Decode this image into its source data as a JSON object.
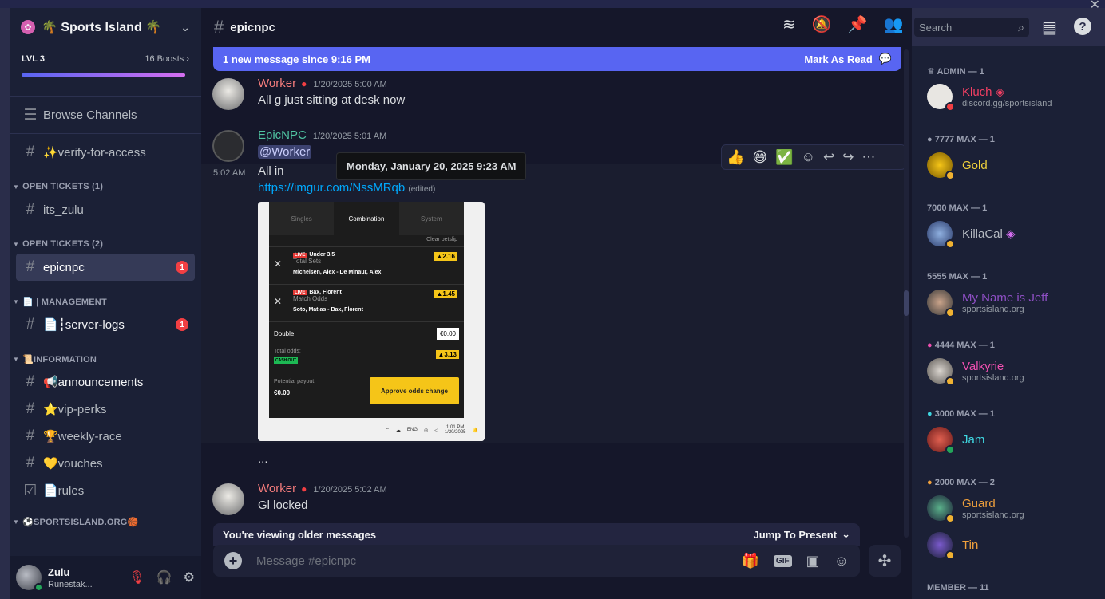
{
  "server": {
    "name": "🌴 Sports Island 🌴",
    "level": "LVL 3",
    "boosts": "16 Boosts"
  },
  "sidebar": {
    "browse": "Browse Channels",
    "verify": "✨verify-for-access",
    "cat_open1": "OPEN TICKETS (1)",
    "ticket1": "its_zulu",
    "cat_open2": "OPEN TICKETS (2)",
    "ticket2": "epicnpc",
    "ticket2_badge": "1",
    "cat_mgmt": "📄 | MANAGEMENT",
    "server_logs": "📄┇server-logs",
    "server_logs_badge": "1",
    "cat_info": "📜INFORMATION",
    "announcements": "📢announcements",
    "vip": "⭐vip-perks",
    "weekly": "🏆weekly-race",
    "vouches": "💛vouches",
    "rules": "📄rules",
    "cat_sports": "⚽SPORTSISLAND.ORG🏀"
  },
  "user": {
    "name": "Zulu",
    "status": "Runestak..."
  },
  "chat": {
    "channel": "epicnpc",
    "new_messages": "1 new message since 9:16 PM",
    "mark_read": "Mark As Read",
    "search_placeholder": "Search",
    "tooltip": "Monday, January 20, 2025 9:23 AM",
    "older": "You're viewing older messages",
    "jump": "Jump To Present",
    "composer_placeholder": "Message #epicnpc",
    "messages": [
      {
        "author": "Worker",
        "time": "1/20/2025 5:00 AM",
        "text": "All g just sitting at desk now"
      },
      {
        "author": "EpicNPC",
        "time": "1/20/2025 5:01 AM",
        "mention": "@Worker",
        "side_time": "5:02 AM",
        "text": "All in",
        "link": "https://imgur.com/NssMRqb",
        "edited": "(edited)",
        "ellipsis": "..."
      },
      {
        "author": "Worker",
        "time": "1/20/2025 5:02 AM",
        "text": "Gl locked"
      }
    ],
    "betslip": {
      "tabs": [
        "Singles",
        "Combination",
        "System"
      ],
      "clear": "Clear betslip",
      "legs": [
        {
          "live": "LIVE",
          "selection": "Under 3.5",
          "market": "Total Sets",
          "match": "Michelsen, Alex - De Minaur, Alex",
          "odds": "▲2.16"
        },
        {
          "live": "LIVE",
          "selection": "Bax, Florent",
          "market": "Match Odds",
          "match": "Soto, Matias - Bax, Florent",
          "odds": "▲1.45"
        }
      ],
      "double": "Double",
      "stake": "€0.00",
      "total_label": "Total odds:",
      "total_odds": "▲3.13",
      "cashout": "CASH OUT",
      "payout_label": "Potential payout:",
      "payout": "€0.00",
      "approve": "Approve odds change",
      "tb_lang": "ENG",
      "tb_time": "1:01 PM",
      "tb_date": "1/20/2025"
    }
  },
  "members": {
    "groups": [
      {
        "label": "ADMIN — 1",
        "members": [
          {
            "name": "Kluch",
            "sub": "discord.gg/sportsisland",
            "color": "#f23f63"
          }
        ]
      },
      {
        "label": "7777 MAX — 1",
        "members": [
          {
            "name": "Gold",
            "sub": "",
            "color": "#f0d23c"
          }
        ]
      },
      {
        "label": "7000 MAX — 1",
        "members": [
          {
            "name": "KillaCal",
            "sub": "",
            "color": "#b5bac1"
          }
        ]
      },
      {
        "label": "5555 MAX — 1",
        "members": [
          {
            "name": "My Name is Jeff",
            "sub": "sportsisland.org",
            "color": "#8e4fc4"
          }
        ]
      },
      {
        "label": "4444 MAX — 1",
        "members": [
          {
            "name": "Valkyrie",
            "sub": "sportsisland.org",
            "color": "#f04fb0"
          }
        ]
      },
      {
        "label": "3000 MAX — 1",
        "members": [
          {
            "name": "Jam",
            "sub": "",
            "color": "#3fd6e0"
          }
        ]
      },
      {
        "label": "2000 MAX — 2",
        "members": [
          {
            "name": "Guard",
            "sub": "sportsisland.org",
            "color": "#f0a03c"
          },
          {
            "name": "Tin",
            "sub": "",
            "color": "#f0a03c"
          }
        ]
      },
      {
        "label": "MEMBER — 11",
        "members": []
      }
    ]
  },
  "colors": {
    "accent": "#5865f2",
    "danger": "#f23f43",
    "online": "#23a55a"
  }
}
